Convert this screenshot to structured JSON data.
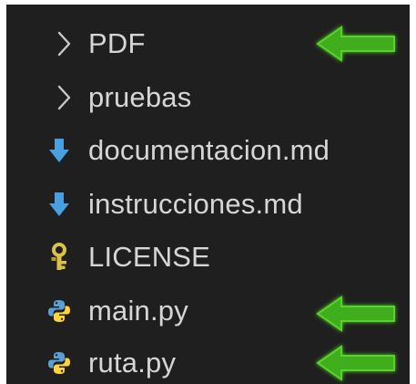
{
  "explorer": {
    "items": [
      {
        "label": "PDF",
        "kind": "folder",
        "icon": "chevron-right-icon",
        "highlighted": true
      },
      {
        "label": "pruebas",
        "kind": "folder",
        "icon": "chevron-right-icon",
        "highlighted": false
      },
      {
        "label": "documentacion.md",
        "kind": "file",
        "icon": "markdown-down-arrow-icon",
        "highlighted": false
      },
      {
        "label": "instrucciones.md",
        "kind": "file",
        "icon": "markdown-down-arrow-icon",
        "highlighted": false
      },
      {
        "label": "LICENSE",
        "kind": "file",
        "icon": "license-key-icon",
        "highlighted": false
      },
      {
        "label": "main.py",
        "kind": "file",
        "icon": "python-icon",
        "highlighted": true
      },
      {
        "label": "ruta.py",
        "kind": "file",
        "icon": "python-icon",
        "highlighted": true
      }
    ]
  },
  "colors": {
    "background": "#1f1f1f",
    "text": "#d6d6d6",
    "chevron": "#c8c8c8",
    "markdown_icon": "#4a9fe0",
    "license_icon": "#d8c24a",
    "python_icon_blue": "#5a9fd4",
    "python_icon_yellow": "#ffd43b",
    "highlight_arrow": "#3fae1f"
  }
}
